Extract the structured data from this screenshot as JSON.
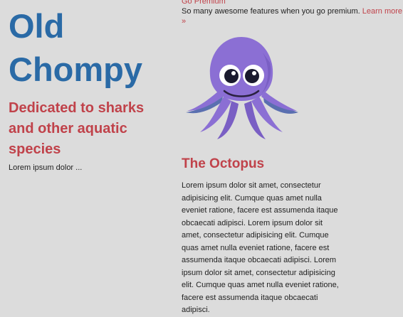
{
  "header": {
    "site_title": "Old Chompy",
    "tagline": "Dedicated to sharks and other aquatic species",
    "left_text": "Lorem ipsum dolor ..."
  },
  "promo": {
    "link_label": "Go Premium",
    "text": "So many awesome features when you go premium.",
    "learn_more": "Learn more »"
  },
  "article": {
    "image_icon": "octopus-icon",
    "heading": "The Octopus",
    "body": "Lorem ipsum dolor sit amet, consectetur adipisicing elit. Cumque quas amet nulla eveniet ratione, facere est assumenda itaque obcaecati adipisci. Lorem ipsum dolor sit amet, consectetur adipisicing elit. Cumque quas amet nulla eveniet ratione, facere est assumenda itaque obcaecati adipisci. Lorem ipsum dolor sit amet, consectetur adipisicing elit. Cumque quas amet nulla eveniet ratione, facere est assumenda itaque obcaecati adipisci."
  },
  "colors": {
    "background": "#dcdcdc",
    "title_blue": "#2a6aa6",
    "accent_red": "#c0424a",
    "octopus_purple": "#8b6fd4"
  }
}
